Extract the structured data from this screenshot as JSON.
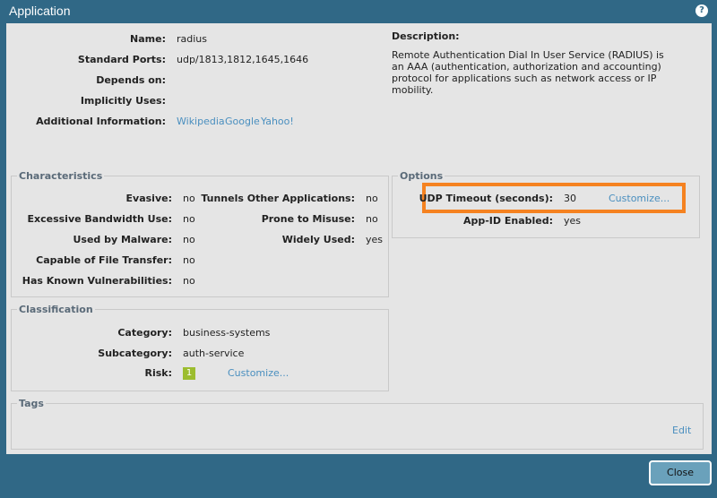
{
  "window": {
    "title": "Application",
    "help_icon": "help-icon"
  },
  "general": {
    "name_label": "Name:",
    "name": "radius",
    "ports_label": "Standard Ports:",
    "ports": "udp/1813,1812,1645,1646",
    "depends_label": "Depends on:",
    "implicit_label": "Implicitly Uses:",
    "additional_label": "Additional Information:",
    "links": [
      "Wikipedia",
      "Google",
      "Yahoo!"
    ],
    "description_label": "Description:",
    "description": "Remote Authentication Dial In User Service (RADIUS) is an AAA (authentication, authorization and accounting) protocol for applications such as network access or IP mobility."
  },
  "characteristics": {
    "title": "Characteristics",
    "left": [
      {
        "label": "Evasive:",
        "value": "no"
      },
      {
        "label": "Excessive Bandwidth Use:",
        "value": "no"
      },
      {
        "label": "Used by Malware:",
        "value": "no"
      },
      {
        "label": "Capable of File Transfer:",
        "value": "no"
      },
      {
        "label": "Has Known Vulnerabilities:",
        "value": "no"
      }
    ],
    "right": [
      {
        "label": "Tunnels Other Applications:",
        "value": "no"
      },
      {
        "label": "Prone to Misuse:",
        "value": "no"
      },
      {
        "label": "Widely Used:",
        "value": "yes"
      }
    ]
  },
  "options": {
    "title": "Options",
    "udp_label": "UDP Timeout (seconds):",
    "udp_value": "30",
    "customize": "Customize...",
    "appid_label": "App-ID Enabled:",
    "appid_value": "yes",
    "highlight_color": "#f58220"
  },
  "classification": {
    "title": "Classification",
    "category_label": "Category:",
    "category": "business-systems",
    "subcategory_label": "Subcategory:",
    "subcategory": "auth-service",
    "risk_label": "Risk:",
    "risk": "1",
    "customize": "Customize..."
  },
  "tags": {
    "title": "Tags",
    "edit": "Edit"
  },
  "footer": {
    "close": "Close"
  }
}
